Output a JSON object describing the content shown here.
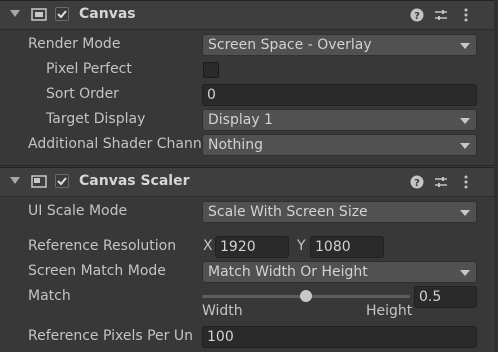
{
  "canvas": {
    "title": "Canvas",
    "render_mode_label": "Render Mode",
    "render_mode_value": "Screen Space - Overlay",
    "pixel_perfect_label": "Pixel Perfect",
    "pixel_perfect_checked": false,
    "sort_order_label": "Sort Order",
    "sort_order_value": "0",
    "target_display_label": "Target Display",
    "target_display_value": "Display 1",
    "additional_shader_label": "Additional Shader Chann",
    "additional_shader_value": "Nothing"
  },
  "canvas_scaler": {
    "title": "Canvas Scaler",
    "ui_scale_mode_label": "UI Scale Mode",
    "ui_scale_mode_value": "Scale With Screen Size",
    "reference_resolution_label": "Reference Resolution",
    "x_label": "X",
    "x_value": "1920",
    "y_label": "Y",
    "y_value": "1080",
    "screen_match_mode_label": "Screen Match Mode",
    "screen_match_mode_value": "Match Width Or Height",
    "match_label": "Match",
    "match_value": "0.5",
    "match_fraction": 0.5,
    "width_label": "Width",
    "height_label": "Height",
    "ref_pixels_label": "Reference Pixels Per Un",
    "ref_pixels_value": "100"
  },
  "icons": [
    "foldout-arrow-icon",
    "canvas-component-icon",
    "canvas-scaler-component-icon",
    "checkmark-icon",
    "help-icon",
    "preset-icon",
    "more-options-icon"
  ]
}
